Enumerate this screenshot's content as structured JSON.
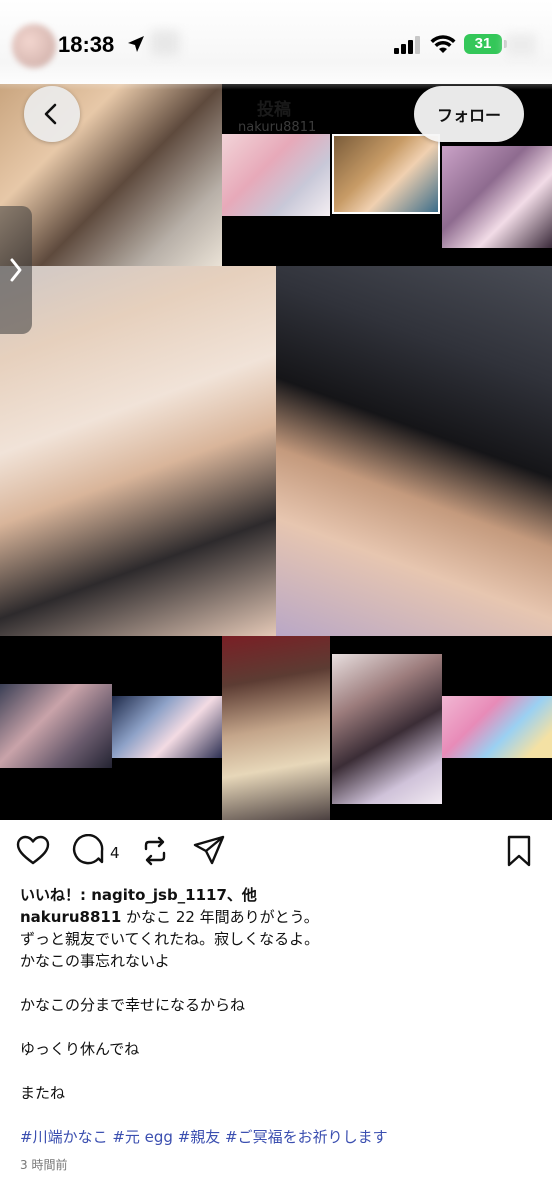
{
  "status_bar": {
    "time": "18:38",
    "battery": "31"
  },
  "post_header": {
    "title": "投稿",
    "subtitle": "nakuru8811",
    "follow_label": "フォロー"
  },
  "actions": {
    "comment_count": "4"
  },
  "caption": {
    "likes_line": "いいね！: nagito_jsb_1117、他",
    "username": "nakuru8811",
    "lines": [
      " かなこ 22 年間ありがとう。",
      "ずっと親友でいてくれたね。寂しくなるよ。",
      "かなこの事忘れないよ",
      "",
      "かなこの分まで幸せになるからね",
      "",
      "ゆっくり休んでね",
      "",
      "またね"
    ],
    "hashtags": "#川端かなこ #元 egg #親友 #ご冥福をお祈りします",
    "timestamp": "3 時間前"
  },
  "icons": {
    "back": "chevron-left-icon",
    "side": "chevron-right-icon",
    "like": "heart-icon",
    "comment": "comment-bubble-icon",
    "repost": "repost-icon",
    "share": "send-icon",
    "save": "bookmark-icon"
  },
  "colors": {
    "battery": "#34c759",
    "hashtag": "#3b4fb0"
  }
}
